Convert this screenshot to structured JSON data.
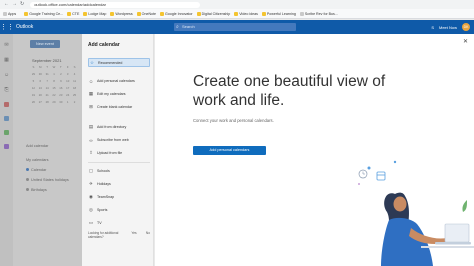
{
  "browser": {
    "url": "outlook.office.com/calendar/addcalendar",
    "bookmarks": [
      "Apps",
      "Google Training Ce...",
      "CTE",
      "Lodge Map",
      "Wordpress",
      "OneNote",
      "Google Innovator",
      "Digital Citizenship",
      "Video ideas",
      "Powerful Learning",
      "Scribe Rev for Bus..."
    ]
  },
  "header": {
    "app_name": "Outlook",
    "search_placeholder": "Search",
    "meet_now": "Meet Now",
    "avatar_initials": "DK"
  },
  "background": {
    "new_event": "New event",
    "month": "September 2021",
    "days": [
      "S",
      "M",
      "T",
      "W",
      "T",
      "F",
      "S",
      "29",
      "30",
      "31",
      "1",
      "2",
      "3",
      "4",
      "5",
      "6",
      "7",
      "8",
      "9",
      "10",
      "11",
      "12",
      "13",
      "14",
      "15",
      "16",
      "17",
      "18",
      "19",
      "20",
      "21",
      "22",
      "23",
      "24",
      "25",
      "26",
      "27",
      "28",
      "29",
      "30",
      "1",
      "2"
    ],
    "add_calendar": "Add calendar",
    "my_calendars": "My calendars",
    "calendar_name": "Calendar",
    "us_holidays": "United States holidays",
    "birthdays": "Birthdays"
  },
  "panel": {
    "title": "Add calendar",
    "items": [
      {
        "label": "Recommended",
        "icon": "star-icon"
      },
      {
        "label": "Add personal calendars",
        "icon": "person-icon"
      },
      {
        "label": "Edit my calendars",
        "icon": "calendar-icon"
      },
      {
        "label": "Create blank calendar",
        "icon": "calendar-plus-icon"
      },
      {
        "label": "Add from directory",
        "icon": "directory-icon"
      },
      {
        "label": "Subscribe from web",
        "icon": "link-icon"
      },
      {
        "label": "Upload from file",
        "icon": "upload-icon"
      },
      {
        "label": "Schools",
        "icon": "school-icon"
      },
      {
        "label": "Holidays",
        "icon": "holiday-icon"
      },
      {
        "label": "TeamSnap",
        "icon": "teamsnap-icon"
      },
      {
        "label": "Sports",
        "icon": "sports-icon"
      },
      {
        "label": "TV",
        "icon": "tv-icon"
      }
    ],
    "footer_question": "Looking for additional calendars?",
    "footer_yes": "Yes",
    "footer_no": "No"
  },
  "main": {
    "hero_title": "Create one beautiful view of work and life.",
    "hero_subtitle": "Connect your work and personal calendars.",
    "cta_label": "Add personal calendars",
    "close_icon": "close-icon"
  },
  "colors": {
    "brand_blue": "#0f5aa8",
    "button_blue": "#0f6cbd",
    "selected_bg": "#d7e6f5"
  }
}
